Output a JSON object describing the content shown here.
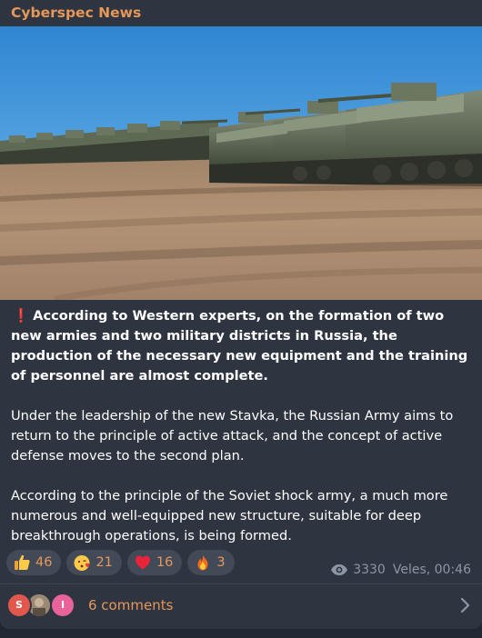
{
  "post": {
    "channel": "Cyberspec News",
    "image_alt": "Row of tanks on a dirt field",
    "paragraphs": {
      "p1": "According to Western experts, on the formation of two new armies and two military districts in Russia, the production of the necessary new equipment and the training of personnel are almost complete.",
      "p2": "Under the leadership of the new Stavka, the Russian Army aims to return to the principle of active attack, and the concept of active defense moves to the second plan.",
      "p3": "According to the principle of the Soviet shock army, a much more numerous and well-equipped new structure, suitable for deep breakthrough operations, is being formed."
    },
    "exclamation": "❗",
    "reactions": [
      {
        "icon": "thumbs-up",
        "count": "46"
      },
      {
        "icon": "heart-kiss-face",
        "count": "21"
      },
      {
        "icon": "heart",
        "count": "16"
      },
      {
        "icon": "fire",
        "count": "3"
      }
    ],
    "views": "3330",
    "author_time": "Veles, 00:46"
  },
  "comments": {
    "avatars": [
      "S",
      "",
      "I"
    ],
    "label": "6 comments"
  },
  "colors": {
    "accent": "#e6975a",
    "background": "#2e3440",
    "muted": "#8c96a6"
  }
}
